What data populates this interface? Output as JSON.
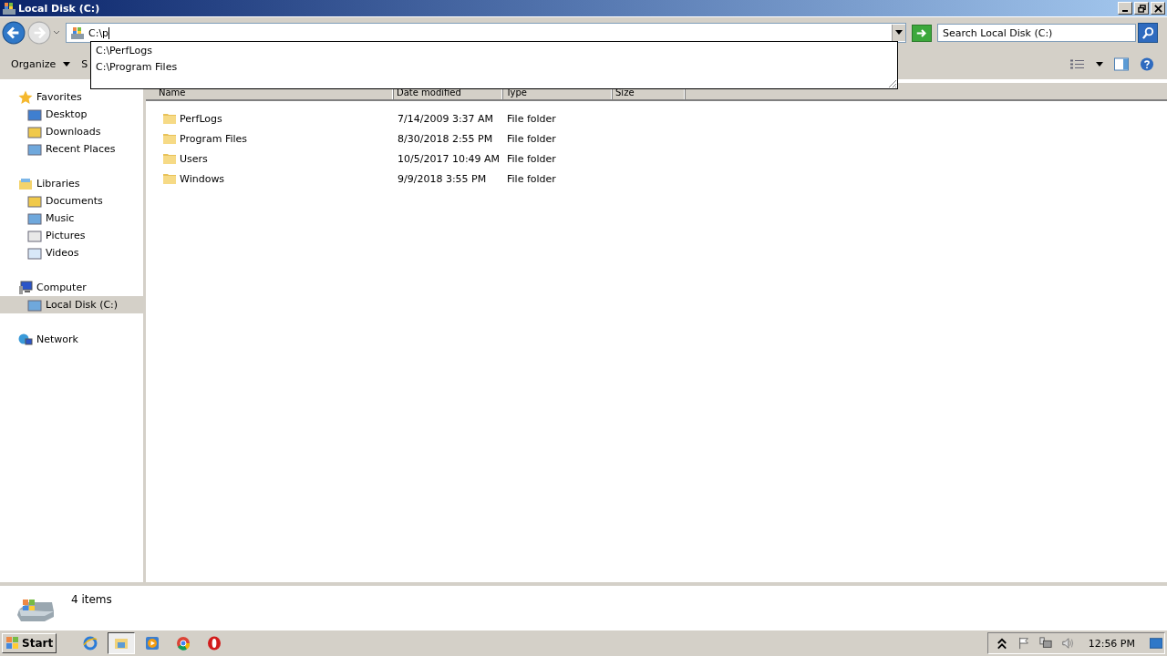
{
  "window": {
    "title": "Local Disk (C:)"
  },
  "address": {
    "value": "C:\\p",
    "suggestions": [
      "C:\\PerfLogs",
      "C:\\Program Files"
    ]
  },
  "search": {
    "placeholder": "Search Local Disk (C:)"
  },
  "toolbar": {
    "buttons": [
      "Organize",
      "S"
    ]
  },
  "sidebar": {
    "items": [
      {
        "label": "Favorites",
        "selected": false,
        "children": [
          {
            "label": "Desktop",
            "selected": false
          },
          {
            "label": "Downloads",
            "selected": false
          },
          {
            "label": "Recent Places",
            "selected": false
          }
        ]
      },
      {
        "label": "Libraries",
        "selected": false,
        "children": [
          {
            "label": "Documents",
            "selected": false
          },
          {
            "label": "Music",
            "selected": false
          },
          {
            "label": "Pictures",
            "selected": false
          },
          {
            "label": "Videos",
            "selected": false
          }
        ]
      },
      {
        "label": "Computer",
        "selected": false,
        "children": [
          {
            "label": "Local Disk (C:)",
            "selected": true
          }
        ]
      },
      {
        "label": "Network",
        "selected": false
      }
    ]
  },
  "table": {
    "columns": [
      "Name",
      "Date modified",
      "Type",
      "Size"
    ],
    "rows": [
      {
        "name": "PerfLogs",
        "date": "7/14/2009 3:37 AM",
        "type": "File folder"
      },
      {
        "name": "Program Files",
        "date": "8/30/2018 2:55 PM",
        "type": "File folder"
      },
      {
        "name": "Users",
        "date": "10/5/2017 10:49 AM",
        "type": "File folder"
      },
      {
        "name": "Windows",
        "date": "9/9/2018 3:55 PM",
        "type": "File folder"
      }
    ]
  },
  "status_bar": {
    "text": "4 items"
  },
  "taskbar": {
    "start": "Start",
    "clock": "12:56 PM"
  }
}
